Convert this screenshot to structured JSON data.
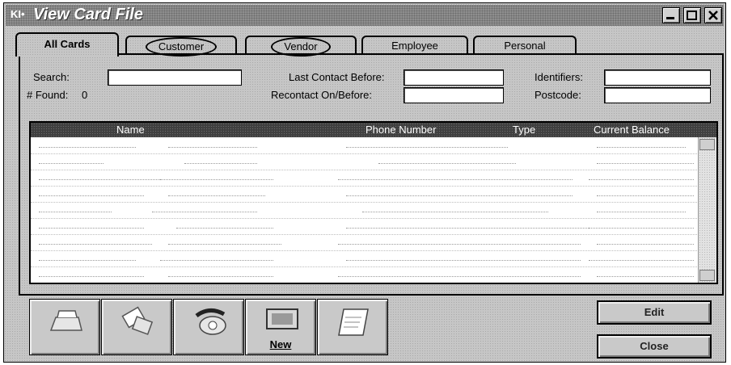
{
  "window": {
    "icon_text": "KI•",
    "title": "View Card File"
  },
  "tabs": [
    {
      "label": "All Cards"
    },
    {
      "label": "Customer"
    },
    {
      "label": "Vendor"
    },
    {
      "label": "Employee"
    },
    {
      "label": "Personal"
    }
  ],
  "filters": {
    "search_label": "Search:",
    "search_value": "",
    "found_label": "# Found:",
    "found_value": "0",
    "last_contact_label": "Last Contact Before:",
    "last_contact_value": "",
    "recontact_label": "Recontact On/Before:",
    "recontact_value": "",
    "identifiers_label": "Identifiers:",
    "identifiers_value": "",
    "postcode_label": "Postcode:",
    "postcode_value": ""
  },
  "grid": {
    "columns": [
      "Name",
      "Phone Number",
      "Type",
      "Current Balance"
    ],
    "rows": []
  },
  "toolbar": {
    "new_label": "New",
    "icons": [
      "card-file-icon",
      "address-cards-icon",
      "phone-icon",
      "new-card-icon",
      "letter-icon"
    ]
  },
  "actions": {
    "edit_label": "Edit",
    "close_label": "Close"
  }
}
